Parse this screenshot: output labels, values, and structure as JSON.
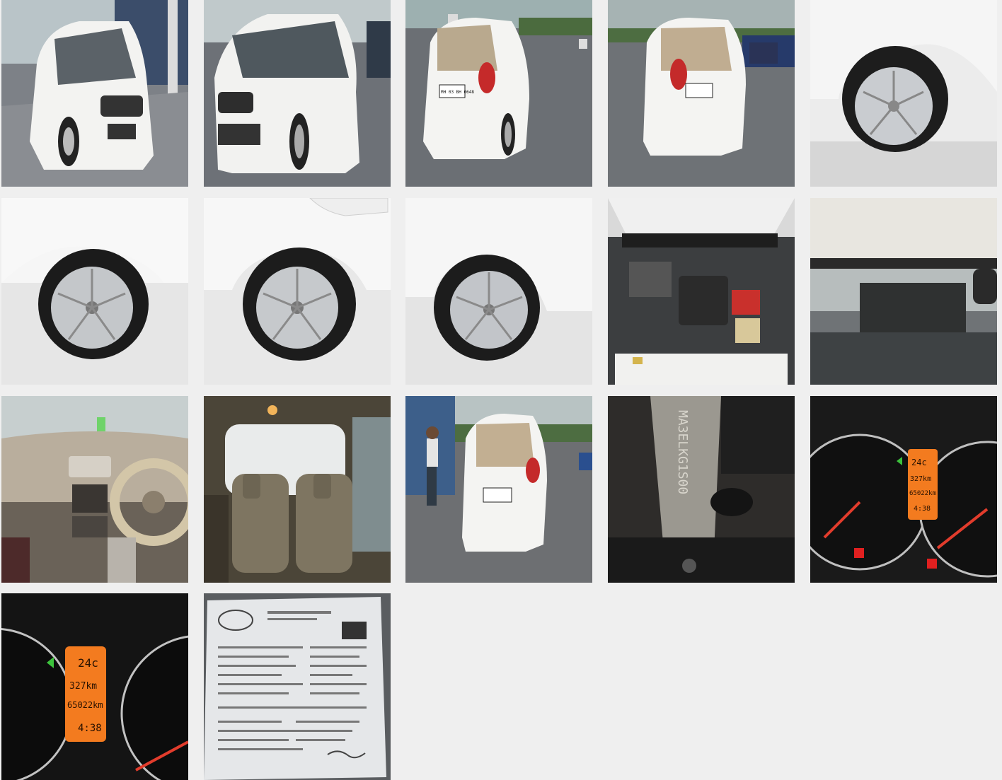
{
  "gallery": {
    "photos": [
      {
        "subject": "front-left-exterior"
      },
      {
        "subject": "front-right-exterior"
      },
      {
        "subject": "rear-left-exterior"
      },
      {
        "subject": "rear-exterior"
      },
      {
        "subject": "front-right-wheel"
      },
      {
        "subject": "front-left-wheel"
      },
      {
        "subject": "rear-left-wheel"
      },
      {
        "subject": "rear-right-wheel"
      },
      {
        "subject": "engine-bay"
      },
      {
        "subject": "underbody"
      },
      {
        "subject": "dashboard-interior"
      },
      {
        "subject": "rear-seats-interior"
      },
      {
        "subject": "rear-exterior-with-person"
      },
      {
        "subject": "chassis-number-stamp"
      },
      {
        "subject": "instrument-cluster"
      },
      {
        "subject": "odometer-closeup"
      },
      {
        "subject": "registration-document"
      }
    ],
    "plate_text": "MH 03 BH 0648",
    "chassis_text": "MA3ELKG1S00",
    "cluster": {
      "temperature": "24c",
      "range": "327km",
      "odometer": "65022km",
      "time": "4:38"
    }
  }
}
